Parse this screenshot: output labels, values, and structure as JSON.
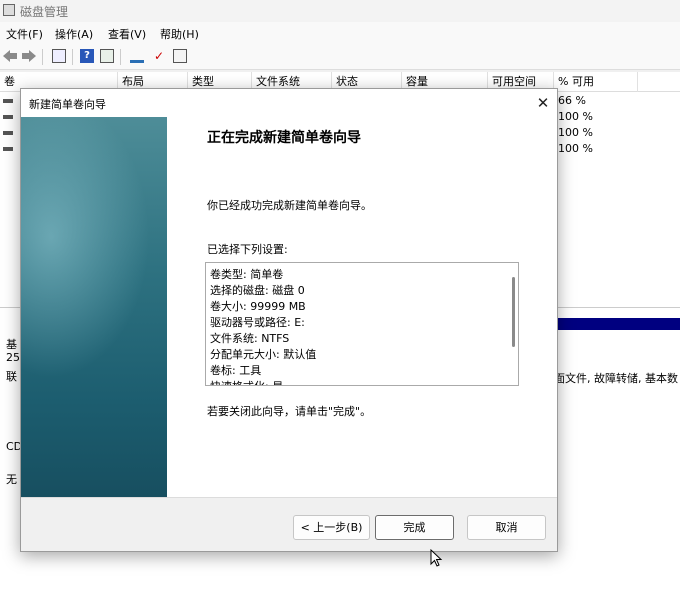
{
  "app": {
    "title": "磁盘管理"
  },
  "menu": [
    "文件(F)",
    "操作(A)",
    "查看(V)",
    "帮助(H)"
  ],
  "list": {
    "columns": [
      "卷",
      "布局",
      "类型",
      "文件系统",
      "状态",
      "容量",
      "可用空间",
      "% 可用"
    ],
    "pct_values": [
      "66 %",
      "100 %",
      "100 %",
      "100 %"
    ]
  },
  "lower": {
    "left_fragments": [
      "基",
      "25",
      "联",
      "CD",
      "无"
    ],
    "partial_status": "面文件, 故障转储, 基本数"
  },
  "dialog": {
    "title": "新建简单卷向导",
    "heading": "正在完成新建简单卷向导",
    "success_text": "你已经成功完成新建简单卷向导。",
    "settings_label": "已选择下列设置:",
    "settings": [
      "卷类型: 简单卷",
      "选择的磁盘: 磁盘 0",
      "卷大小: 99999 MB",
      "驱动器号或路径: E:",
      "文件系统: NTFS",
      "分配单元大小: 默认值",
      "卷标: 工具",
      "快速格式化: 是"
    ],
    "close_hint": "若要关闭此向导，请单击\"完成\"。",
    "buttons": {
      "back": "< 上一步(B)",
      "finish": "完成",
      "cancel": "取消"
    }
  },
  "colors": {
    "banner": "#2e7281",
    "selection_bar": "#000080"
  }
}
